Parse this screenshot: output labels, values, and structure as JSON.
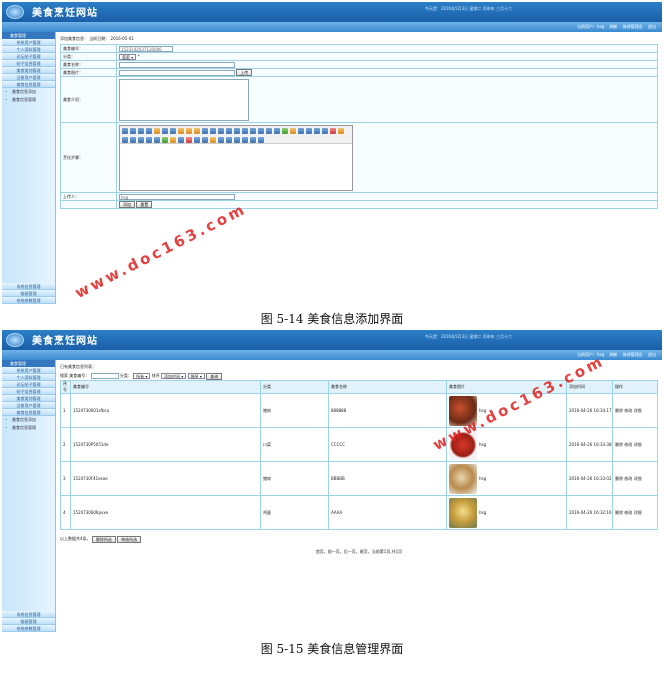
{
  "common": {
    "site_title": "美食烹饪网站",
    "top_info": "今天是：2016年5月3日 星期二 丙申年 三月十六",
    "top_links": [
      "当前用户：hsg",
      "刷新",
      "修改管理员",
      "退出"
    ],
    "sidebar_head": "美食管理",
    "sidebar_items": [
      "系统用户管理",
      "个人资料管理",
      "论坛帖子管理",
      "帖子信息管理",
      "美食类别管理",
      "注册用户管理",
      "美食信息管理"
    ],
    "sidebar_subs": [
      "美食信息添加",
      "美食信息管理"
    ],
    "sidebar_bottom": [
      "系统信息管理",
      "链接管理",
      "系统参数管理"
    ],
    "watermark": "www.doc163.com"
  },
  "screen1": {
    "breadcrumb": "添加美食信息： 当前日期： 2016-05-01",
    "fields": [
      {
        "label": "美食编号：",
        "value": "1523142037130006"
      },
      {
        "label": "分类：",
        "value": "葡萄"
      },
      {
        "label": "美食名称：",
        "value": ""
      },
      {
        "label": "美食图片：",
        "value": ""
      },
      {
        "label": "美食介绍：",
        "value": ""
      },
      {
        "label": "烹饪步骤：",
        "value": ""
      },
      {
        "label": "上传人：",
        "value": "hsg"
      }
    ],
    "upload_button": "上传",
    "submit_button": "添加",
    "reset_button": "重置"
  },
  "caption1": "图 5-14 美食信息添加界面",
  "screen2": {
    "breadcrumb": "已有美食信息列表：",
    "search_label": "搜索",
    "search_field_label": "美食编号：",
    "category_label": "分类：",
    "category_value": "所有",
    "sort_label": "排序",
    "sort_value": "添加时间",
    "order_value": "降序",
    "search_button": "查询",
    "columns": [
      "序号",
      "美食编号",
      "分类",
      "美食名称",
      "美食图片",
      "添加时间",
      "操作"
    ],
    "rows": [
      {
        "index": "1",
        "code": "1524730601sfbca",
        "category": "猪肉",
        "name": "888888",
        "uploader": "hsg",
        "time": "2016-04-26 16:34:17",
        "actions": "删除 修改 详细"
      },
      {
        "index": "2",
        "code": "1524730P5051de",
        "category": "川菜",
        "name": "CCCCC",
        "uploader": "hsg",
        "time": "2016-04-26 16:33:38",
        "actions": "删除 修改 详细"
      },
      {
        "index": "3",
        "code": "1524730F41esae",
        "category": "猪肉",
        "name": "BBBBB",
        "uploader": "hsg",
        "time": "2016-04-26 16:33:02",
        "actions": "删除 修改 详细"
      },
      {
        "index": "4",
        "code": "1524730606pvxe",
        "category": "鸡蛋",
        "name": "AAAA",
        "uploader": "hsg",
        "time": "2016-04-26 16:32:16",
        "actions": "删除 修改 详细"
      }
    ],
    "total_text": "以上数据共4条，",
    "delete_selected_button": "删除所选",
    "review_selected_button": "审核所选",
    "pager": "首页，前一页，后一页，尾页，当前第1页,共1页"
  },
  "caption2": "图 5-15 美食信息管理界面",
  "colors": {
    "header": "#1a5fa8",
    "nav": "#3a8ad0",
    "border": "#9cd3e6",
    "watermark": "#e02020"
  }
}
